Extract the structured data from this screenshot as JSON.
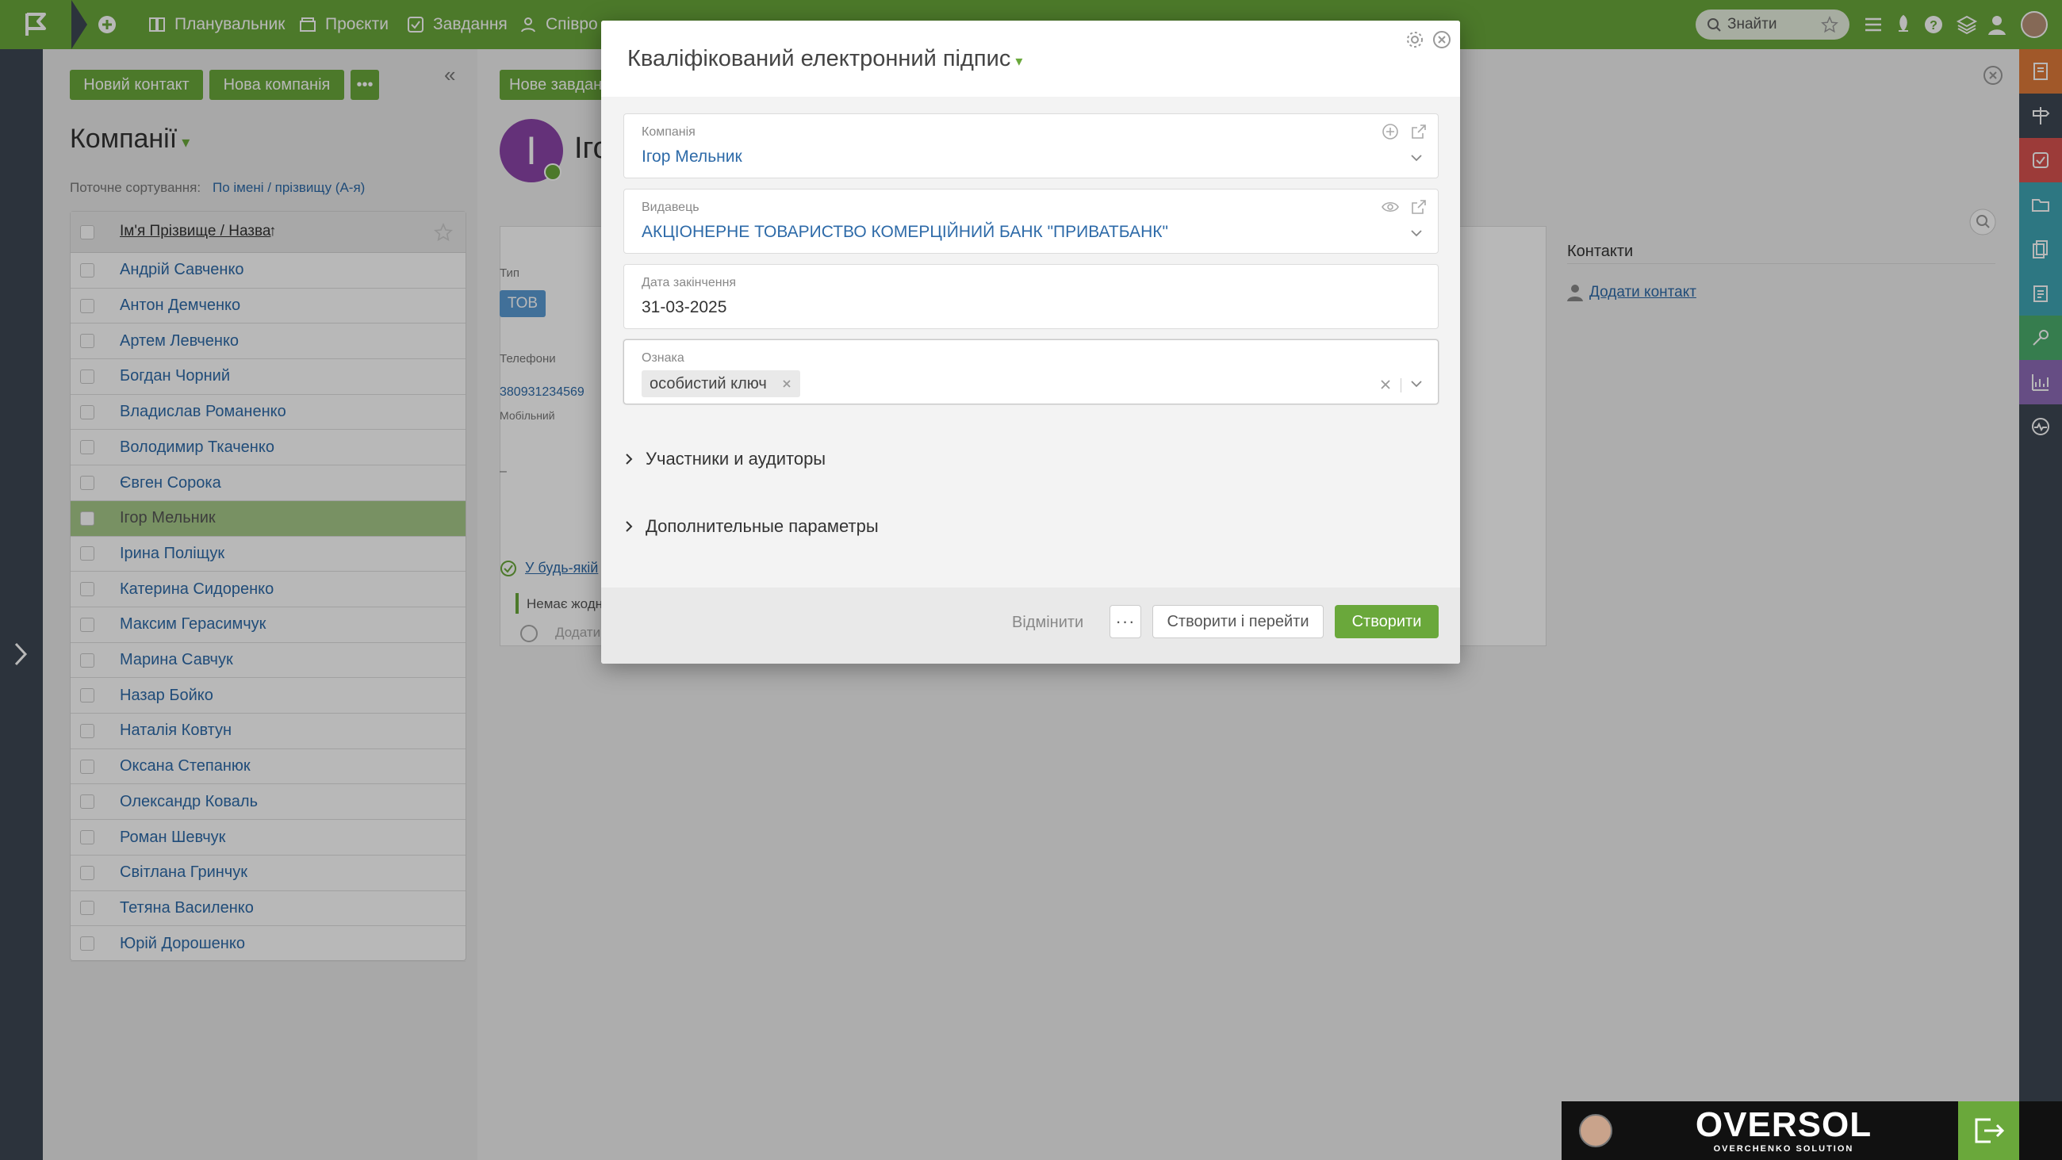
{
  "topbar": {
    "nav": [
      "Планувальник",
      "Проєкти",
      "Завдання",
      "Співро"
    ],
    "search_placeholder": "Знайти"
  },
  "list": {
    "new_contact_label": "Новий контакт",
    "new_company_label": "Нова компанія",
    "more_label": "•••",
    "collapse_label": "«",
    "title": "Компанії",
    "sort_label": "Поточне сортування:",
    "sort_value": "По імені / прізвищу (А-я)",
    "column_header": "Ім'я Прізвище / Назва",
    "sort_arrow": "↑",
    "rows": [
      "Андрій Савченко",
      "Антон Демченко",
      "Артем Левченко",
      "Богдан Чорний",
      "Владислав Романенко",
      "Володимир Ткаченко",
      "Євген Сорока",
      "Ігор Мельник",
      "Ірина Поліщук",
      "Катерина Сидоренко",
      "Максим Герасимчук",
      "Марина Савчук",
      "Назар Бойко",
      "Наталія Ковтун",
      "Оксана Степанюк",
      "Олександр Коваль",
      "Роман Шевчук",
      "Світлана Гринчук",
      "Тетяна Василенко",
      "Юрій Дорошенко"
    ],
    "selected_index": 7
  },
  "detail": {
    "new_task_label": "Нове завдання",
    "avatar_letter": "I",
    "name_partial": "Іго",
    "type_label": "Тип",
    "type_value": "ТОВ",
    "phones_label": "Телефони",
    "phone_value": "380931234569",
    "phone_type": "Мобільний",
    "dash": "–",
    "task_filter": "У будь-якій",
    "no_tasks": "Немає жодн",
    "add_task": "Додати",
    "contacts_title": "Контакти",
    "add_contact": "Додати контакт"
  },
  "modal": {
    "title": "Кваліфікований електронний підпис",
    "company": {
      "label": "Компанія",
      "value": "Ігор Мельник"
    },
    "issuer": {
      "label": "Видавець",
      "value": "АКЦІОНЕРНЕ ТОВАРИСТВО КОМЕРЦІЙНИЙ БАНК \"ПРИВАТБАНК\""
    },
    "expiry": {
      "label": "Дата закінчення",
      "value": "31-03-2025"
    },
    "tag_field": {
      "label": "Ознака",
      "tag": "особистий ключ"
    },
    "section_participants": "Участники и аудиторы",
    "section_params": "Дополнительные параметры",
    "cancel_label": "Відмінити",
    "more_label": "···",
    "create_go_label": "Створити і перейти",
    "create_label": "Створити"
  },
  "brand": {
    "name": "OVERSOL",
    "tagline": "OVERCHENKO SOLUTION"
  },
  "colors": {
    "green": "#6aa83b",
    "link": "#2d6aa8",
    "rail": "#3e4754"
  },
  "icons": [
    "logo-flag-icon",
    "add-icon",
    "calendar-icon",
    "projects-icon",
    "tasks-icon",
    "people-icon",
    "search-icon",
    "star-icon",
    "menu-icon",
    "rocket-icon",
    "help-icon",
    "layers-icon",
    "user-icon",
    "settings-icon",
    "close-icon",
    "plus-circle-icon",
    "external-link-icon",
    "eye-icon",
    "chevron-down-icon",
    "chevron-right-icon",
    "logout-icon"
  ]
}
